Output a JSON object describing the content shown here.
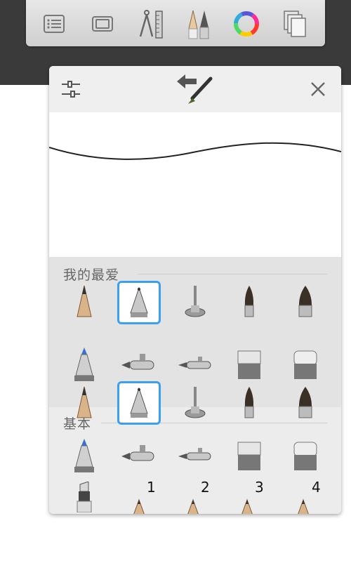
{
  "toolbar": {
    "items": [
      {
        "name": "layers-list"
      },
      {
        "name": "canvas"
      },
      {
        "name": "guides-ruler"
      },
      {
        "name": "brushes"
      },
      {
        "name": "color-wheel"
      },
      {
        "name": "copy-layers"
      }
    ]
  },
  "panel": {
    "sections": [
      {
        "title": "我的最爱"
      },
      {
        "title": "基本"
      }
    ],
    "sizes": [
      "1",
      "2",
      "3",
      "4"
    ]
  },
  "colors": {
    "accent": "#3c9ff0",
    "toolbar_bg": "#d9d9d9",
    "dark_band": "#3a3a3a"
  }
}
